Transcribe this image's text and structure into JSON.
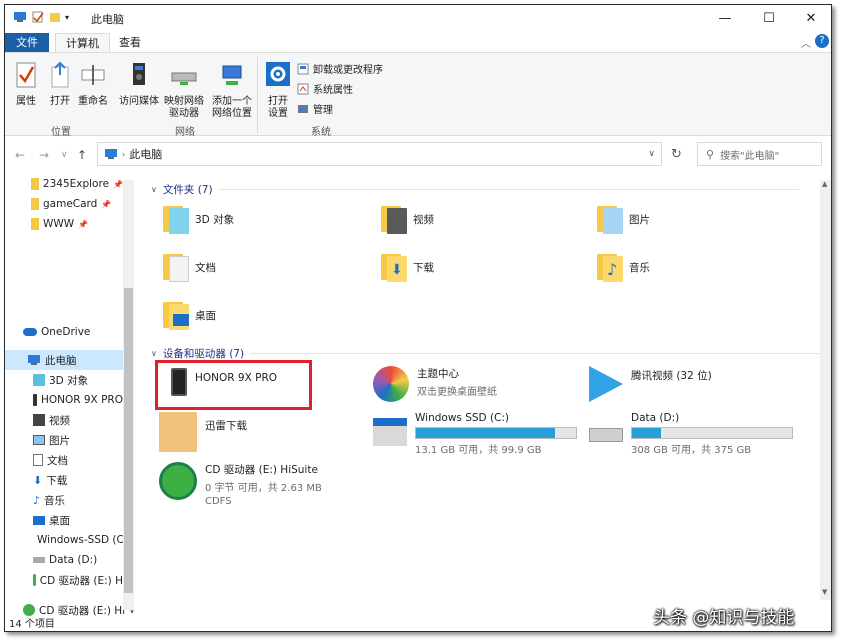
{
  "window": {
    "title": "此电脑",
    "minimize": "—",
    "maximize": "☐",
    "close": "✕"
  },
  "ribbon_tabs": {
    "file": "文件",
    "computer": "计算机",
    "view": "查看"
  },
  "ribbon": {
    "properties": "属性",
    "open": "打开",
    "rename": "重命名",
    "access_media": "访问媒体",
    "map_drive_1": "映射网络",
    "map_drive_2": "驱动器",
    "add_location_1": "添加一个",
    "add_location_2": "网络位置",
    "open_settings_1": "打开",
    "open_settings_2": "设置",
    "uninstall": "卸载或更改程序",
    "system_props": "系统属性",
    "manage": "管理",
    "group_location": "位置",
    "group_network": "网络",
    "group_system": "系统"
  },
  "address": {
    "path": "此电脑",
    "search_placeholder": "搜索\"此电脑\""
  },
  "nav": {
    "quick": [
      "2345Explore",
      "gameCard",
      "WWW"
    ],
    "onedrive": "OneDrive",
    "this_pc": "此电脑",
    "items": [
      "3D 对象",
      "HONOR 9X PRO",
      "视频",
      "图片",
      "文档",
      "下载",
      "音乐",
      "桌面",
      "Windows-SSD (C",
      "Data (D:)",
      "CD 驱动器 (E:) H"
    ],
    "cd_bottom": "CD 驱动器 (E:) Hi"
  },
  "folders_section": "文件夹 (7)",
  "folders": [
    "3D 对象",
    "视频",
    "图片",
    "文档",
    "下载",
    "音乐",
    "桌面"
  ],
  "devices_section": "设备和驱动器 (7)",
  "devices": {
    "honor": "HONOR 9X PRO",
    "theme": "主题中心",
    "theme_sub": "双击更换桌面壁纸",
    "tencent": "腾讯视频 (32 位)",
    "xunlei": "迅雷下载",
    "c_name": "Windows SSD (C:)",
    "c_sub": "13.1 GB 可用，共 99.9 GB",
    "c_used": 0.87,
    "d_name": "Data (D:)",
    "d_sub": "308 GB 可用，共 375 GB",
    "d_used": 0.18,
    "cd_name": "CD 驱动器 (E:) HiSuite",
    "cd_sub1": "0 字节 可用，共 2.63 MB",
    "cd_sub2": "CDFS"
  },
  "status": "14 个项目",
  "watermark": "头条 @知识与技能"
}
